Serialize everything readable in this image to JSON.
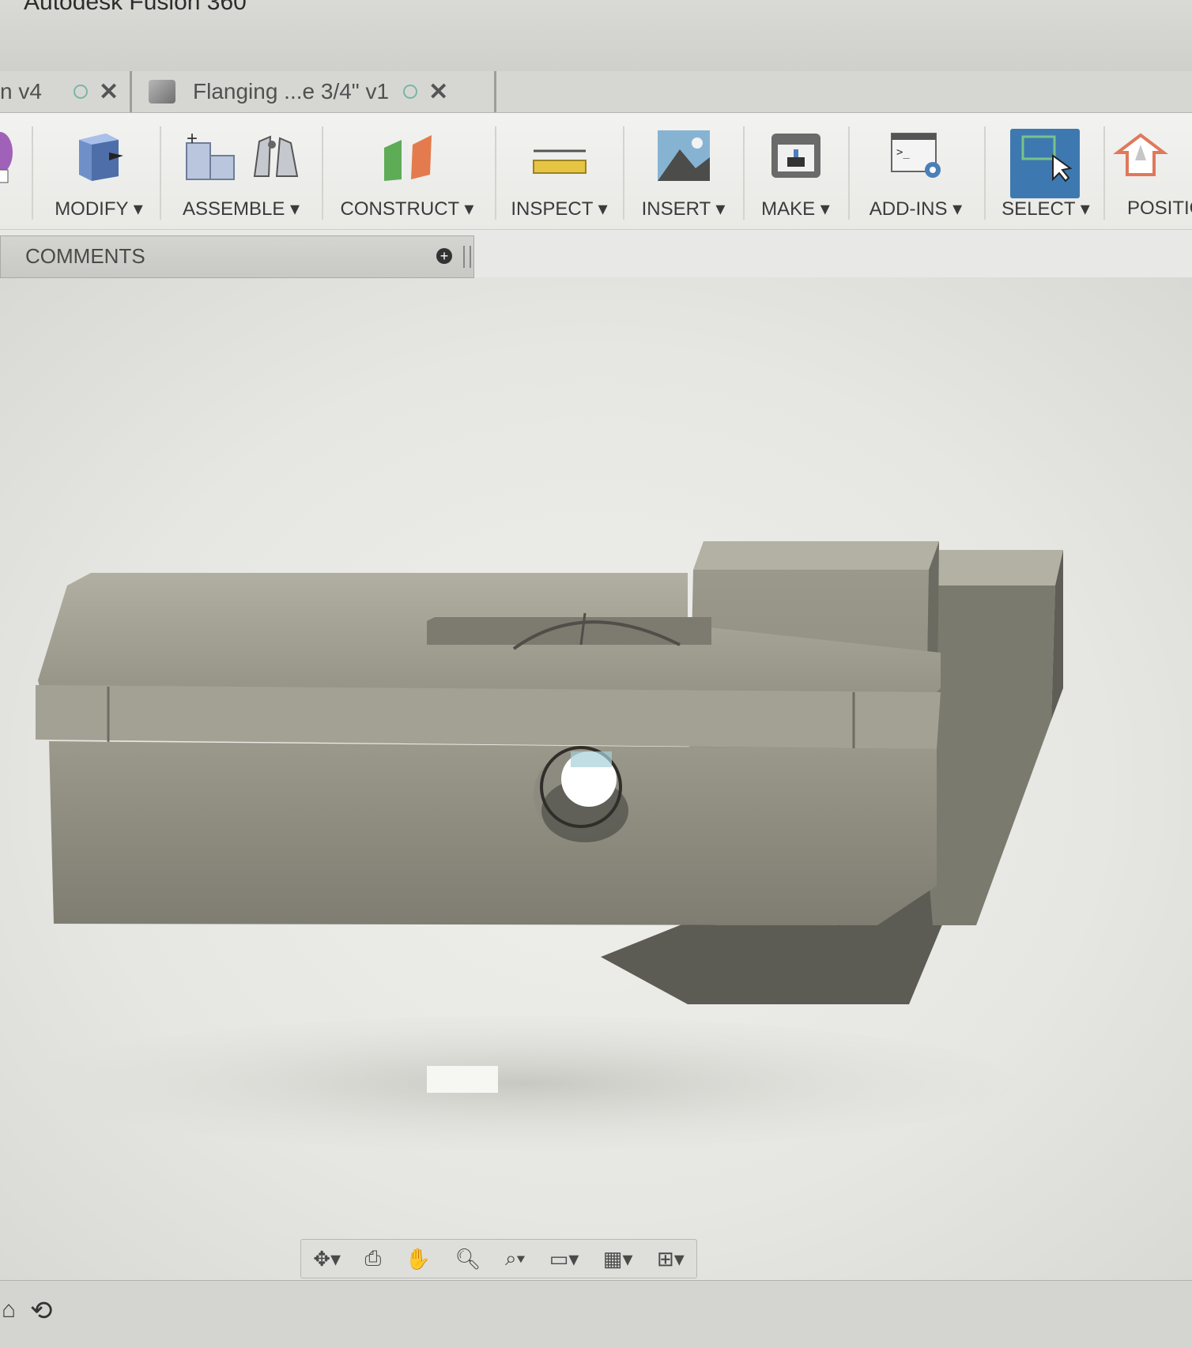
{
  "window": {
    "title": "Autodesk Fusion 360"
  },
  "tabs": [
    {
      "label": "n v4"
    },
    {
      "label": "Flanging ...e 3/4\" v1"
    }
  ],
  "new_tab_label": "+",
  "toolbar": {
    "modify": "MODIFY ▾",
    "assemble": "ASSEMBLE ▾",
    "construct": "CONSTRUCT ▾",
    "inspect": "INSPECT ▾",
    "insert": "INSERT ▾",
    "make": "MAKE ▾",
    "addins": "ADD-INS ▾",
    "select": "SELECT ▾",
    "position": "POSITIO"
  },
  "comments": {
    "label": "COMMENTS"
  },
  "icons": {
    "close": "close-icon",
    "dot": "status-dot-icon",
    "add": "add-icon"
  },
  "colors": {
    "select_active": "#3d79b0",
    "model_face": "#8c8a7c",
    "model_shadow": "#5d5c54"
  }
}
